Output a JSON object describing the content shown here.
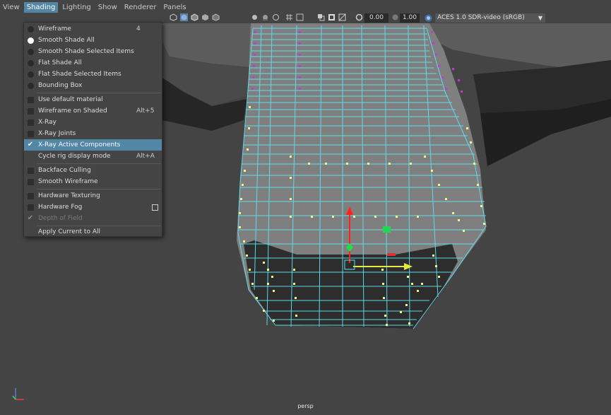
{
  "menubar": {
    "items": [
      "View",
      "Shading",
      "Lighting",
      "Show",
      "Renderer",
      "Panels"
    ],
    "active": "Shading"
  },
  "toolbar": {
    "field_1": "0.00",
    "field_2": "1.00",
    "colorspace": "ACES 1.0 SDR-video (sRGB)"
  },
  "shading_menu": {
    "items": [
      {
        "label": "Wireframe",
        "shortcut": "4",
        "indicator": "radio-off"
      },
      {
        "label": "Smooth Shade All",
        "shortcut": "",
        "indicator": "radio-on"
      },
      {
        "label": "Smooth Shade Selected Items",
        "shortcut": "",
        "indicator": "radio-off"
      },
      {
        "label": "Flat Shade All",
        "shortcut": "",
        "indicator": "radio-off"
      },
      {
        "label": "Flat Shade Selected Items",
        "shortcut": "",
        "indicator": "radio-off"
      },
      {
        "label": "Bounding Box",
        "shortcut": "",
        "indicator": "radio-off"
      },
      {
        "label": "Use default material",
        "shortcut": "",
        "indicator": "checkbox-off"
      },
      {
        "label": "Wireframe on Shaded",
        "shortcut": "Alt+5",
        "indicator": "checkbox-off"
      },
      {
        "label": "X-Ray",
        "shortcut": "",
        "indicator": "checkbox-off"
      },
      {
        "label": "X-Ray Joints",
        "shortcut": "",
        "indicator": "checkbox-off"
      },
      {
        "label": "X-Ray Active Components",
        "shortcut": "",
        "indicator": "check",
        "highlighted": true
      },
      {
        "label": "Cycle rig display mode",
        "shortcut": "Alt+A",
        "indicator": "none"
      },
      {
        "label": "Backface Culling",
        "shortcut": "",
        "indicator": "checkbox-off"
      },
      {
        "label": "Smooth Wireframe",
        "shortcut": "",
        "indicator": "checkbox-off"
      },
      {
        "label": "Hardware Texturing",
        "shortcut": "",
        "indicator": "checkbox-off"
      },
      {
        "label": "Hardware Fog",
        "shortcut": "",
        "indicator": "checkbox-off",
        "option_box": true
      },
      {
        "label": "Depth of Field",
        "shortcut": "",
        "indicator": "check",
        "disabled": true
      },
      {
        "label": "Apply Current to All",
        "shortcut": "",
        "indicator": "none"
      }
    ]
  },
  "viewport": {
    "camera_label": "persp"
  },
  "colors": {
    "menu_highlight": "#5285a6",
    "wire_cyan": "#5fe0f0",
    "vertex_yellow": "#f4f486",
    "vertex_magenta": "#c23bd6",
    "background": "#444444"
  }
}
